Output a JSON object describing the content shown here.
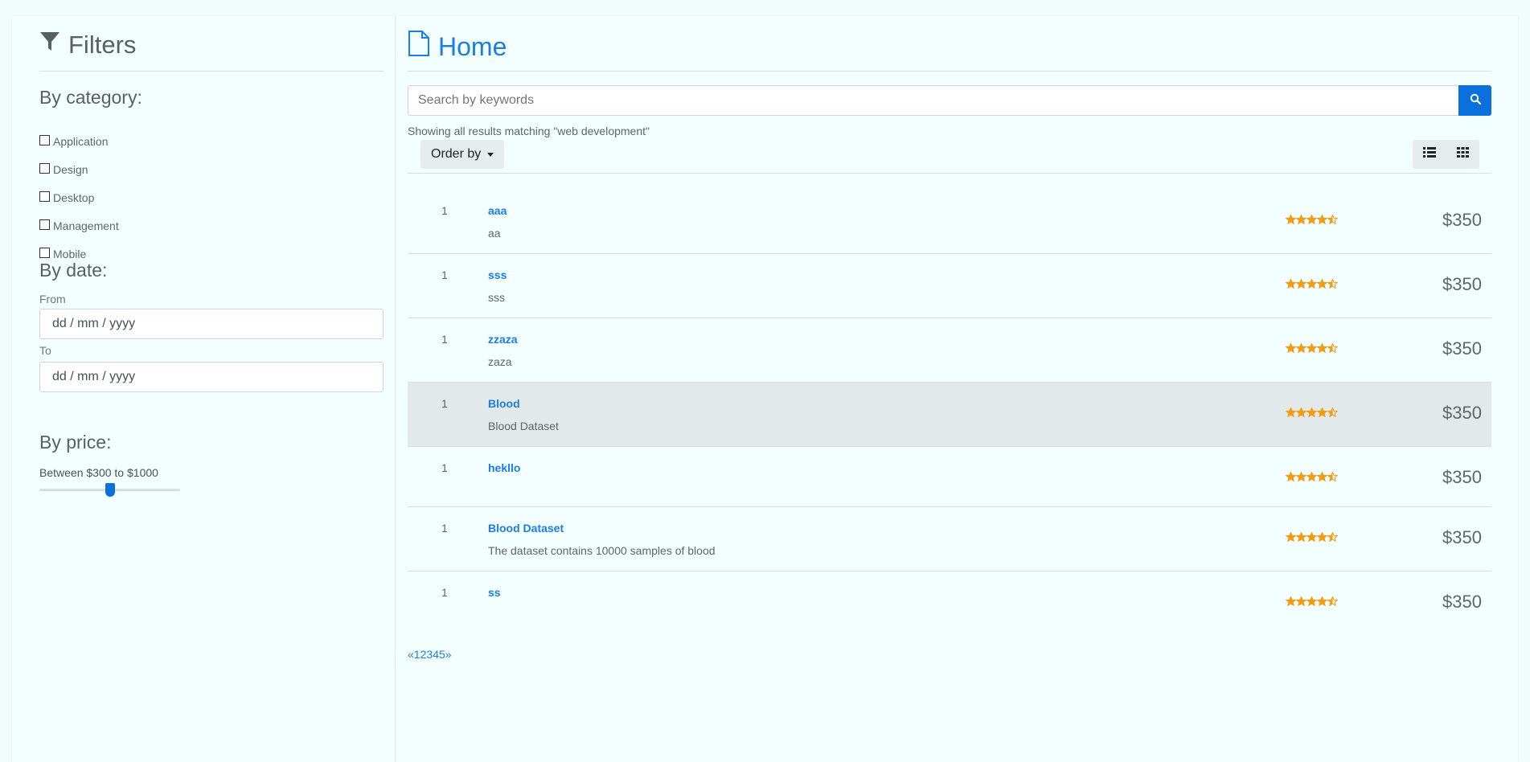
{
  "sidebar": {
    "title": "Filters",
    "category_heading": "By category:",
    "categories": [
      "Application",
      "Design",
      "Desktop",
      "Management",
      "Mobile"
    ],
    "date_heading": "By date:",
    "from_label": "From",
    "to_label": "To",
    "date_placeholder": "dd / mm / yyyy",
    "price_heading": "By price:",
    "price_prefix": "Between ",
    "price_min": "$300",
    "price_to": " to ",
    "price_max": "$1000",
    "price_slider_position": 0.5
  },
  "main": {
    "title": "Home",
    "search_placeholder": "Search by keywords",
    "results_info": "Showing all results matching \"web development\"",
    "order_by_label": "Order by",
    "items": [
      {
        "num": "1",
        "name": "aaa",
        "desc": "aa",
        "rating": 4.5,
        "price": "$350"
      },
      {
        "num": "1",
        "name": "sss",
        "desc": "sss",
        "rating": 4.5,
        "price": "$350"
      },
      {
        "num": "1",
        "name": "zzaza",
        "desc": "zaza",
        "rating": 4.5,
        "price": "$350"
      },
      {
        "num": "1",
        "name": "Blood",
        "desc": "Blood Dataset",
        "rating": 4.5,
        "price": "$350"
      },
      {
        "num": "1",
        "name": "hekllo",
        "desc": "",
        "rating": 4.5,
        "price": "$350"
      },
      {
        "num": "1",
        "name": "Blood Dataset",
        "desc": "The dataset contains 10000 samples of blood",
        "rating": 4.5,
        "price": "$350"
      },
      {
        "num": "1",
        "name": "ss",
        "desc": "",
        "rating": 4.5,
        "price": "$350"
      }
    ],
    "pagination": [
      "«",
      "1",
      "2",
      "3",
      "4",
      "5",
      "»"
    ]
  },
  "colors": {
    "accent": "#1a7fe0",
    "star": "#f39c12",
    "highlight_row": "#e3e9ea"
  }
}
